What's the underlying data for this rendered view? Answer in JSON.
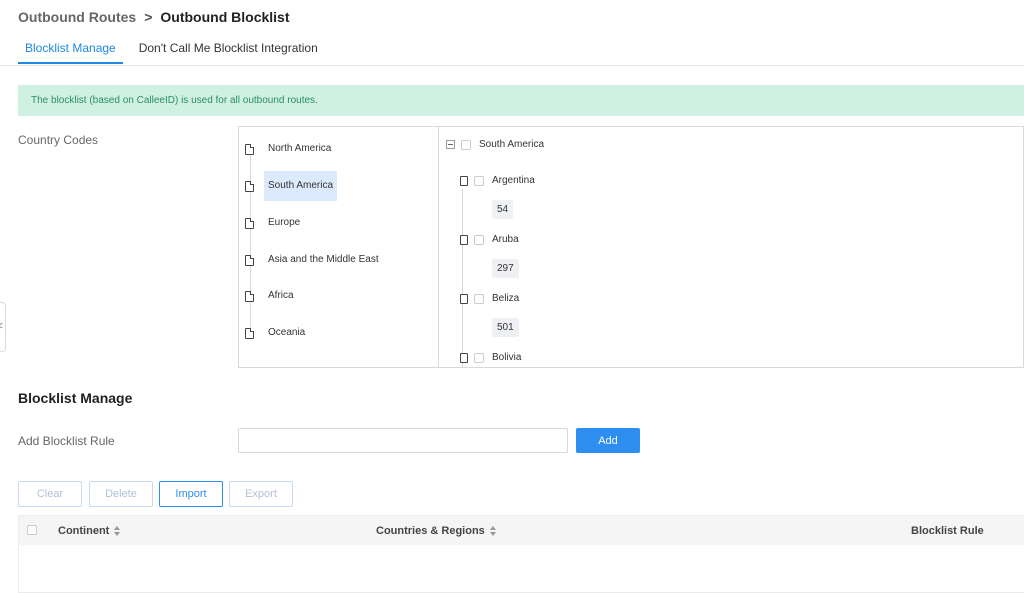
{
  "breadcrumb": {
    "parent": "Outbound Routes",
    "separator": ">",
    "current": "Outbound Blocklist"
  },
  "tabs": [
    {
      "label": "Blocklist Manage",
      "active": true
    },
    {
      "label": "Don't Call Me Blocklist Integration",
      "active": false
    }
  ],
  "notice": "The blocklist (based on CalleeID) is used for all outbound routes.",
  "side_handle": {
    "icon": "chevron-left-icon",
    "glyph": "<"
  },
  "country_codes": {
    "label": "Country Codes",
    "regions": [
      {
        "label": "North America",
        "selected": false
      },
      {
        "label": "South America",
        "selected": true
      },
      {
        "label": "Europe",
        "selected": false
      },
      {
        "label": "Asia and the Middle East",
        "selected": false
      },
      {
        "label": "Africa",
        "selected": false
      },
      {
        "label": "Oceania",
        "selected": false
      }
    ],
    "tree_root": "South America",
    "countries": [
      {
        "name": "Argentina",
        "code": "54"
      },
      {
        "name": "Aruba",
        "code": "297"
      },
      {
        "name": "Beliza",
        "code": "501"
      },
      {
        "name": "Bolivia",
        "code": ""
      }
    ]
  },
  "blocklist": {
    "title": "Blocklist Manage",
    "add_rule_label": "Add Blocklist Rule",
    "input_value": "",
    "add_button": "Add",
    "actions": {
      "clear": "Clear",
      "delete": "Delete",
      "import": "Import",
      "export": "Export"
    }
  },
  "table": {
    "columns": [
      "Continent",
      "Countries & Regions",
      "Blocklist Rule"
    ],
    "rows": []
  },
  "colors": {
    "accent": "#2d8ef0",
    "notice_bg": "#cff0e2",
    "notice_text": "#2a8f63",
    "selected_bg": "#dbeafd"
  }
}
